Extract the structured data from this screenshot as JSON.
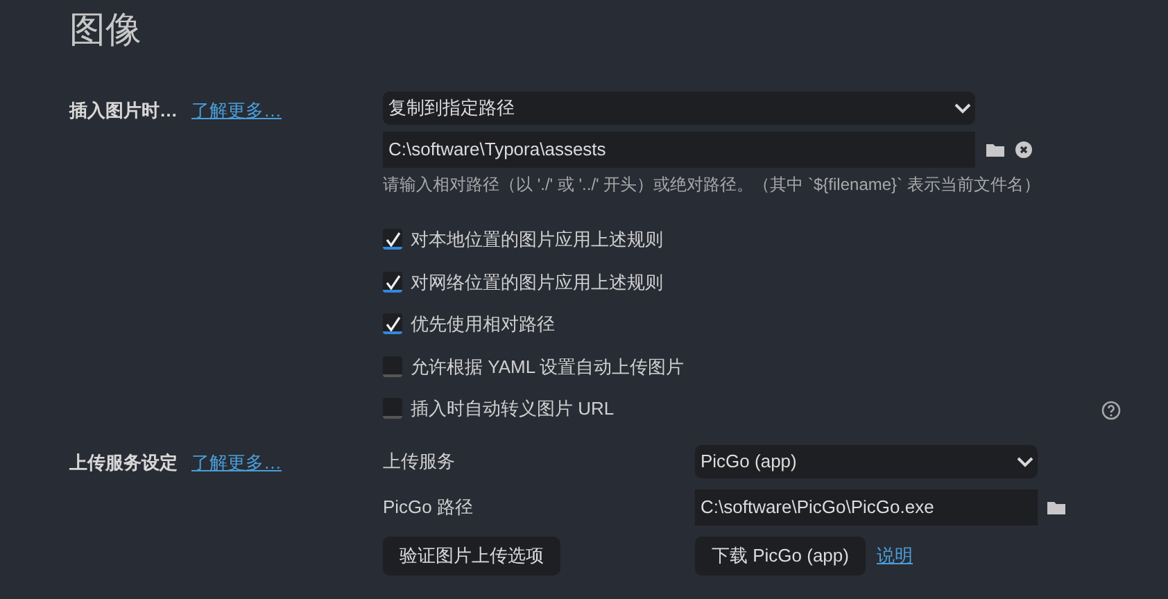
{
  "title": "图像",
  "insert": {
    "label": "插入图片时…",
    "link": "了解更多…",
    "select": "复制到指定路径",
    "path": "C:\\software\\Typora\\assests",
    "hint": "请输入相对路径（以 './' 或 '../' 开头）或绝对路径。（其中 `${filename}` 表示当前文件名）",
    "options": [
      {
        "label": "对本地位置的图片应用上述规则",
        "checked": true
      },
      {
        "label": "对网络位置的图片应用上述规则",
        "checked": true
      },
      {
        "label": "优先使用相对路径",
        "checked": true
      },
      {
        "label": "允许根据 YAML 设置自动上传图片",
        "checked": false
      },
      {
        "label": "插入时自动转义图片 URL",
        "checked": false
      }
    ]
  },
  "upload": {
    "label": "上传服务设定",
    "link": "了解更多…",
    "service_label": "上传服务",
    "service": "PicGo (app)",
    "path_label": "PicGo 路径",
    "path": "C:\\software\\PicGo\\PicGo.exe",
    "verify_button": "验证图片上传选项",
    "download_button": "下载 PicGo (app)",
    "help_link": "说明"
  }
}
